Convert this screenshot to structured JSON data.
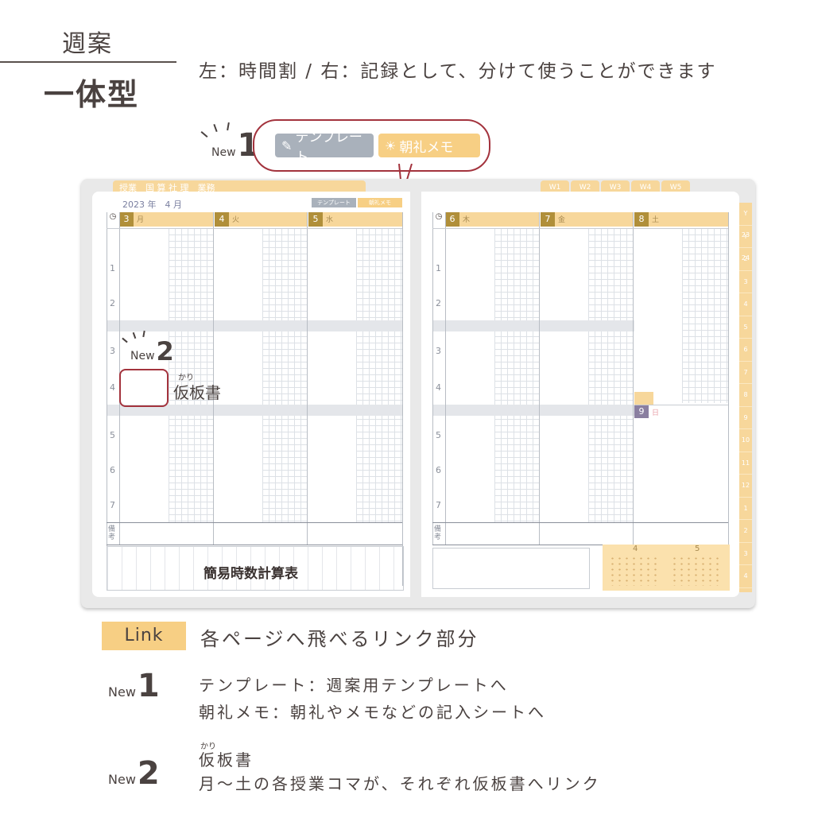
{
  "header": {
    "title_top": "週案",
    "title_bottom": "一体型",
    "subtitle": "左：時間割 / 右：記録として、分けて使うことができます"
  },
  "badges": {
    "new_word": "New",
    "new1_num": "1",
    "new2_num": "2"
  },
  "callout": {
    "template_label": "テンプレート",
    "morning_label": "朝礼メモ"
  },
  "planner": {
    "left_tabs": "授業　国 算 社 理　業務",
    "week_tabs": [
      "W1",
      "W2",
      "W3",
      "W4",
      "W5"
    ],
    "side_tabs": [
      "Y 23",
      "Y 24",
      "2",
      "3",
      "4",
      "5",
      "6",
      "7",
      "8",
      "9",
      "10",
      "11",
      "12",
      "1",
      "2",
      "3",
      "4"
    ],
    "date_line": "2023 年　4 月",
    "mini_template": "テンプレート",
    "mini_morning": "朝礼メモ",
    "left_days": [
      {
        "num": "3",
        "wd": "月"
      },
      {
        "num": "4",
        "wd": "火"
      },
      {
        "num": "5",
        "wd": "水"
      }
    ],
    "right_days": [
      {
        "num": "6",
        "wd": "木"
      },
      {
        "num": "7",
        "wd": "金"
      },
      {
        "num": "8",
        "wd": "土"
      }
    ],
    "sunday": {
      "num": "9",
      "wd": "日"
    },
    "periods": [
      "1",
      "2",
      "3",
      "4",
      "5",
      "6",
      "7"
    ],
    "remarks_label": "備考",
    "calc_label": "簡易時数計算表",
    "cal_months": [
      "4",
      "5"
    ]
  },
  "annotation": {
    "kana_ruby": "かり",
    "kana_label": "仮板書"
  },
  "legend": {
    "link_tag": "Link",
    "link_desc": "各ページへ飛べるリンク部分",
    "item1_line1": "テンプレート：週案用テンプレートへ",
    "item1_line2": "朝礼メモ：朝礼やメモなどの記入シートへ",
    "item2_ruby": "かり",
    "item2_line1": "仮板書",
    "item2_line2": "月～土の各授業コマが、それぞれ仮板書へリンク"
  },
  "colors": {
    "accent_yellow": "#f7cf84",
    "accent_red": "#a3333d",
    "tag_gray": "#a9b1bb",
    "text": "#4a4240"
  }
}
